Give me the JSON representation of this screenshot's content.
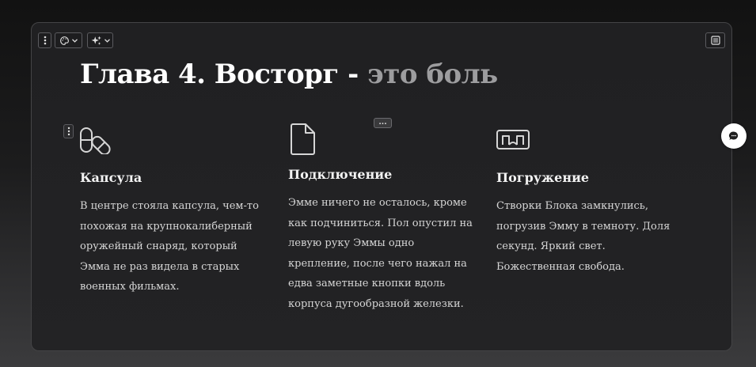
{
  "title": {
    "main": "Глава 4. Восторг - ",
    "accent": "это боль"
  },
  "toolbar": {
    "left_icons": [
      "kebab-icon",
      "palette-icon",
      "sparkle-icon"
    ],
    "right_icon": "page-layout-icon"
  },
  "block_tools": {
    "handle_icon": "kebab-icon",
    "more_label": "..."
  },
  "columns": [
    {
      "icon": "pills-icon",
      "heading": "Капсула",
      "text": "В центре стояла капсула, чем-то похожая на крупнокалиберный оружейный снаряд, который Эмма не раз видела в старых военных фильмах."
    },
    {
      "icon": "file-icon",
      "heading": "Подключение",
      "text": "Эмме ничего не осталось, кроме как подчиниться. Пол опустил на левую руку Эммы одно крепление, после чего нажал на едва заметные кнопки вдоль корпуса дугообразной железки."
    },
    {
      "icon": "vr-headset-icon",
      "heading": "Погружение",
      "text": "Створки Блока замкнулись, погрузив Эмму в темноту. Доля секунд. Яркий свет. Божественная свобода."
    }
  ],
  "floating_action": {
    "icon": "comment-icon"
  },
  "colors": {
    "title_main": "#ffffff",
    "title_accent": "#9d9d9f",
    "card_bg": "#212123",
    "page_bg": "#151515"
  }
}
